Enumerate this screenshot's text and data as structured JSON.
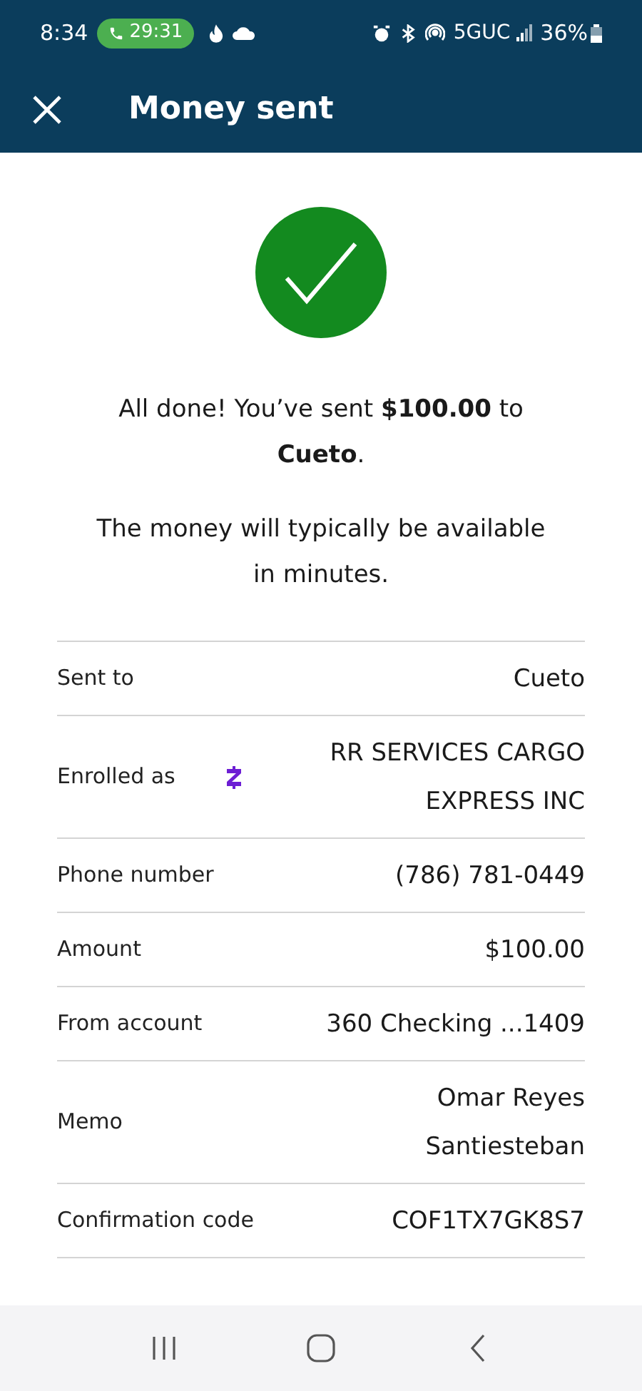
{
  "status_bar": {
    "time": "8:34",
    "call_timer": "29:31",
    "network": "5GUC",
    "battery": "36%"
  },
  "header": {
    "title": "Money sent"
  },
  "message": "All done! You’ve sent **$100.00** to **Cueto**.",
  "note": "The money will typically be available in minutes.",
  "details": [
    {
      "label": "Sent to",
      "value": "Cueto",
      "kind": "plain"
    },
    {
      "label": "Enrolled as",
      "value": "RR SERVICES CARGO EXPRESS INC",
      "kind": "with_icon"
    },
    {
      "label": "Phone number",
      "value": "(786) 781-0449",
      "kind": "plain"
    },
    {
      "label": "Amount",
      "value": "$100.00",
      "kind": "plain"
    },
    {
      "label": "From account",
      "value": "360 Checking ...1409",
      "kind": "plain"
    },
    {
      "label": "Memo",
      "value": "Omar Reyes Santiesteban",
      "kind": "plain"
    },
    {
      "label": "Confirmation code",
      "value": "COF1TX7GK8S7",
      "kind": "plain"
    }
  ]
}
